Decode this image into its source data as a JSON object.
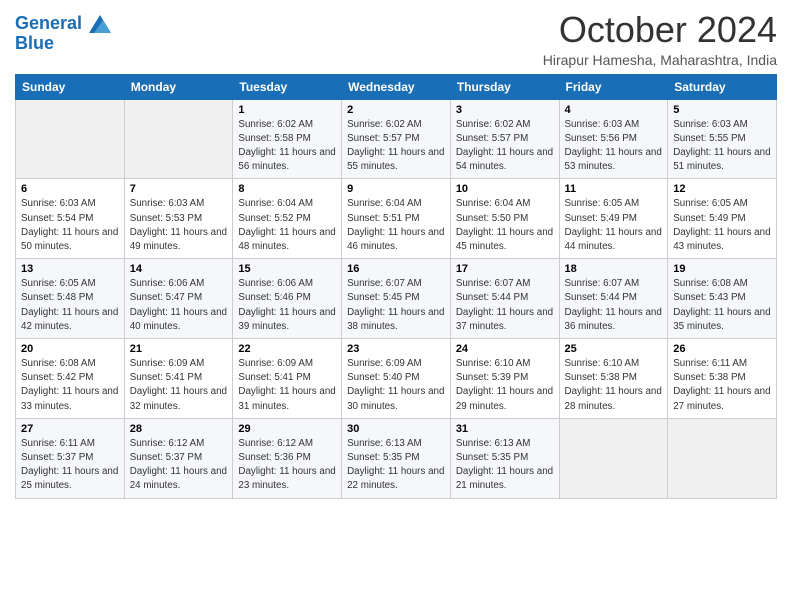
{
  "logo": {
    "line1": "General",
    "line2": "Blue"
  },
  "title": "October 2024",
  "location": "Hirapur Hamesha, Maharashtra, India",
  "days_of_week": [
    "Sunday",
    "Monday",
    "Tuesday",
    "Wednesday",
    "Thursday",
    "Friday",
    "Saturday"
  ],
  "weeks": [
    [
      {
        "day": "",
        "info": ""
      },
      {
        "day": "",
        "info": ""
      },
      {
        "day": "1",
        "info": "Sunrise: 6:02 AM\nSunset: 5:58 PM\nDaylight: 11 hours and 56 minutes."
      },
      {
        "day": "2",
        "info": "Sunrise: 6:02 AM\nSunset: 5:57 PM\nDaylight: 11 hours and 55 minutes."
      },
      {
        "day": "3",
        "info": "Sunrise: 6:02 AM\nSunset: 5:57 PM\nDaylight: 11 hours and 54 minutes."
      },
      {
        "day": "4",
        "info": "Sunrise: 6:03 AM\nSunset: 5:56 PM\nDaylight: 11 hours and 53 minutes."
      },
      {
        "day": "5",
        "info": "Sunrise: 6:03 AM\nSunset: 5:55 PM\nDaylight: 11 hours and 51 minutes."
      }
    ],
    [
      {
        "day": "6",
        "info": "Sunrise: 6:03 AM\nSunset: 5:54 PM\nDaylight: 11 hours and 50 minutes."
      },
      {
        "day": "7",
        "info": "Sunrise: 6:03 AM\nSunset: 5:53 PM\nDaylight: 11 hours and 49 minutes."
      },
      {
        "day": "8",
        "info": "Sunrise: 6:04 AM\nSunset: 5:52 PM\nDaylight: 11 hours and 48 minutes."
      },
      {
        "day": "9",
        "info": "Sunrise: 6:04 AM\nSunset: 5:51 PM\nDaylight: 11 hours and 46 minutes."
      },
      {
        "day": "10",
        "info": "Sunrise: 6:04 AM\nSunset: 5:50 PM\nDaylight: 11 hours and 45 minutes."
      },
      {
        "day": "11",
        "info": "Sunrise: 6:05 AM\nSunset: 5:49 PM\nDaylight: 11 hours and 44 minutes."
      },
      {
        "day": "12",
        "info": "Sunrise: 6:05 AM\nSunset: 5:49 PM\nDaylight: 11 hours and 43 minutes."
      }
    ],
    [
      {
        "day": "13",
        "info": "Sunrise: 6:05 AM\nSunset: 5:48 PM\nDaylight: 11 hours and 42 minutes."
      },
      {
        "day": "14",
        "info": "Sunrise: 6:06 AM\nSunset: 5:47 PM\nDaylight: 11 hours and 40 minutes."
      },
      {
        "day": "15",
        "info": "Sunrise: 6:06 AM\nSunset: 5:46 PM\nDaylight: 11 hours and 39 minutes."
      },
      {
        "day": "16",
        "info": "Sunrise: 6:07 AM\nSunset: 5:45 PM\nDaylight: 11 hours and 38 minutes."
      },
      {
        "day": "17",
        "info": "Sunrise: 6:07 AM\nSunset: 5:44 PM\nDaylight: 11 hours and 37 minutes."
      },
      {
        "day": "18",
        "info": "Sunrise: 6:07 AM\nSunset: 5:44 PM\nDaylight: 11 hours and 36 minutes."
      },
      {
        "day": "19",
        "info": "Sunrise: 6:08 AM\nSunset: 5:43 PM\nDaylight: 11 hours and 35 minutes."
      }
    ],
    [
      {
        "day": "20",
        "info": "Sunrise: 6:08 AM\nSunset: 5:42 PM\nDaylight: 11 hours and 33 minutes."
      },
      {
        "day": "21",
        "info": "Sunrise: 6:09 AM\nSunset: 5:41 PM\nDaylight: 11 hours and 32 minutes."
      },
      {
        "day": "22",
        "info": "Sunrise: 6:09 AM\nSunset: 5:41 PM\nDaylight: 11 hours and 31 minutes."
      },
      {
        "day": "23",
        "info": "Sunrise: 6:09 AM\nSunset: 5:40 PM\nDaylight: 11 hours and 30 minutes."
      },
      {
        "day": "24",
        "info": "Sunrise: 6:10 AM\nSunset: 5:39 PM\nDaylight: 11 hours and 29 minutes."
      },
      {
        "day": "25",
        "info": "Sunrise: 6:10 AM\nSunset: 5:38 PM\nDaylight: 11 hours and 28 minutes."
      },
      {
        "day": "26",
        "info": "Sunrise: 6:11 AM\nSunset: 5:38 PM\nDaylight: 11 hours and 27 minutes."
      }
    ],
    [
      {
        "day": "27",
        "info": "Sunrise: 6:11 AM\nSunset: 5:37 PM\nDaylight: 11 hours and 25 minutes."
      },
      {
        "day": "28",
        "info": "Sunrise: 6:12 AM\nSunset: 5:37 PM\nDaylight: 11 hours and 24 minutes."
      },
      {
        "day": "29",
        "info": "Sunrise: 6:12 AM\nSunset: 5:36 PM\nDaylight: 11 hours and 23 minutes."
      },
      {
        "day": "30",
        "info": "Sunrise: 6:13 AM\nSunset: 5:35 PM\nDaylight: 11 hours and 22 minutes."
      },
      {
        "day": "31",
        "info": "Sunrise: 6:13 AM\nSunset: 5:35 PM\nDaylight: 11 hours and 21 minutes."
      },
      {
        "day": "",
        "info": ""
      },
      {
        "day": "",
        "info": ""
      }
    ]
  ]
}
